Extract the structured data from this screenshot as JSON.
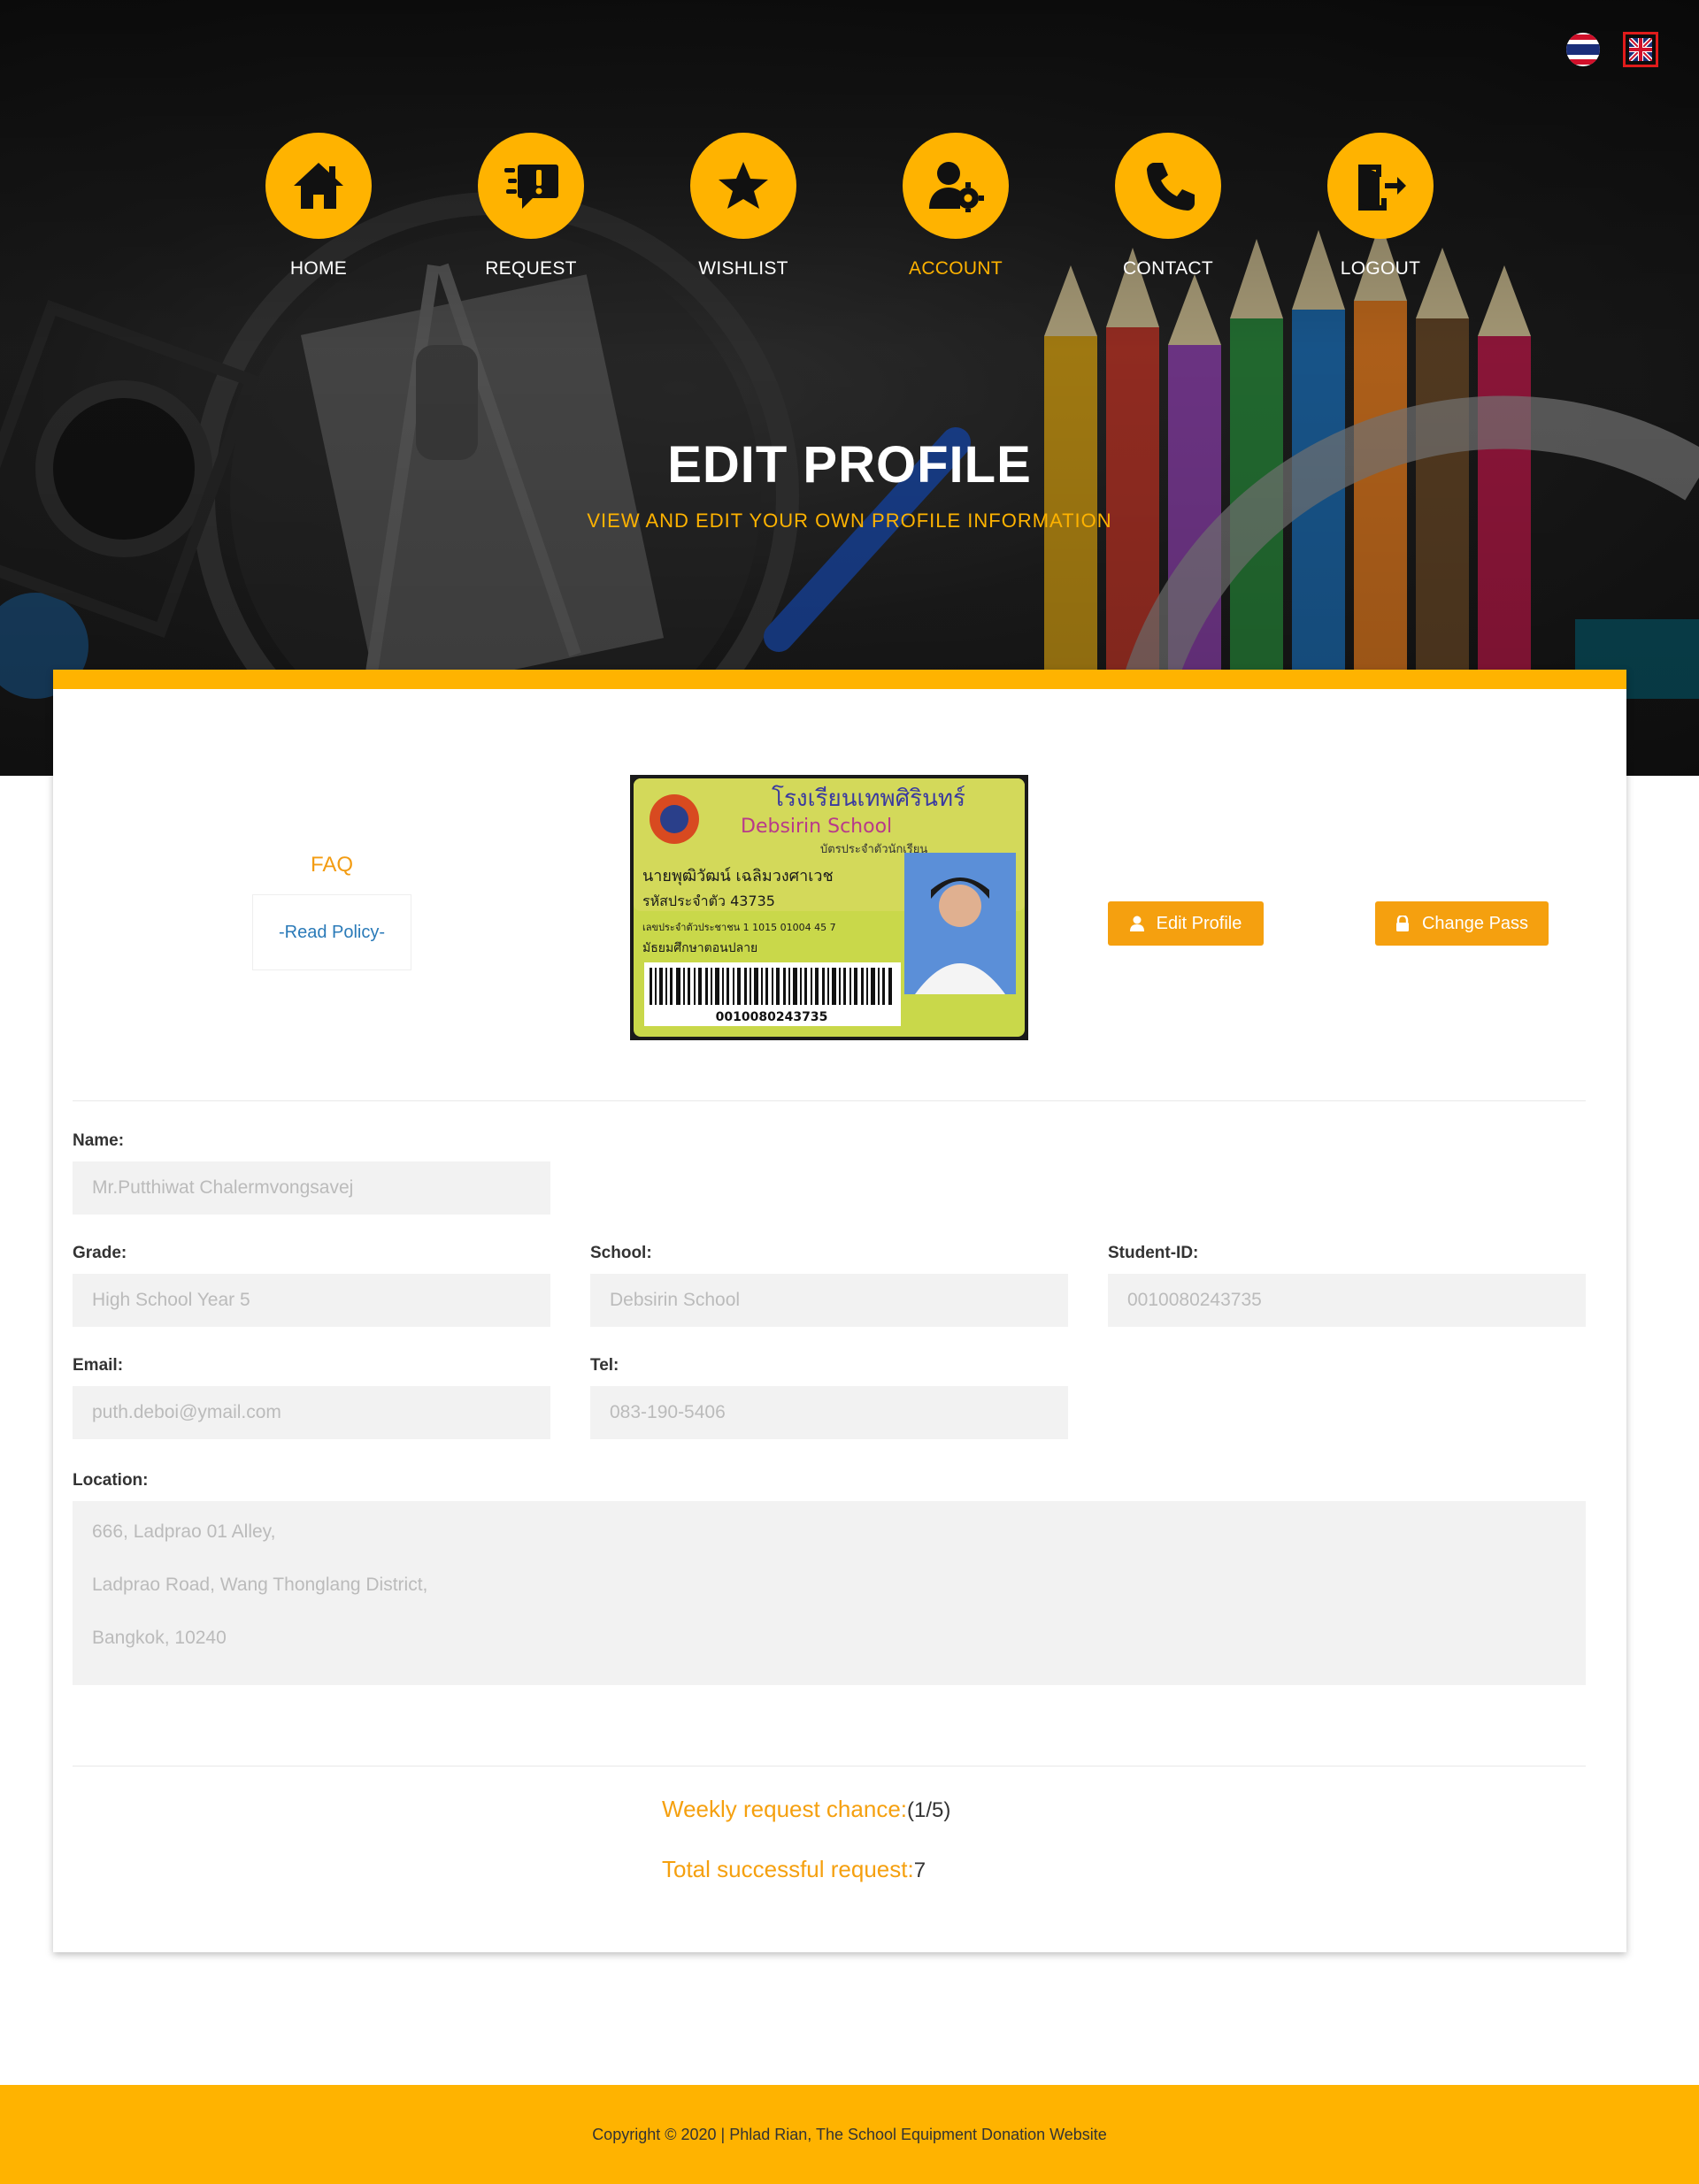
{
  "languages": [
    {
      "code": "th",
      "icon": "thai-flag-icon"
    },
    {
      "code": "en",
      "icon": "uk-flag-icon",
      "selected": true
    }
  ],
  "nav": {
    "items": [
      {
        "label": "HOME",
        "icon": "home-icon"
      },
      {
        "label": "REQUEST",
        "icon": "request-icon"
      },
      {
        "label": "WISHLIST",
        "icon": "star-icon"
      },
      {
        "label": "ACCOUNT",
        "icon": "user-gear-icon",
        "active": true
      },
      {
        "label": "CONTACT",
        "icon": "phone-icon"
      },
      {
        "label": "LOGOUT",
        "icon": "logout-door-icon"
      }
    ],
    "accent": "#ffb300"
  },
  "hero": {
    "title": "EDIT PROFILE",
    "subtitle": "VIEW AND EDIT YOUR OWN PROFILE INFORMATION"
  },
  "faq": {
    "title": "FAQ",
    "link": "-Read Policy-"
  },
  "id_card": {
    "school_thai": "โรงเรียนเทพศิรินทร์",
    "school_en": "Debsirin School",
    "card_title": "บัตรประจำตัวนักเรียน",
    "student_name": "นายพุฒิวัฒน์ เฉลิมวงศาเวช",
    "code_line": "รหัสประจำตัว 43735",
    "id_line": "เลขประจำตัวประชาชน 1 1015 01004 45 7",
    "level_line": "มัธยมศึกษาตอนปลาย",
    "barcode_number": "0010080243735"
  },
  "actions": {
    "edit_profile": "Edit Profile",
    "change_pass": "Change Pass"
  },
  "form": {
    "name_label": "Name:",
    "name_value": "Mr.Putthiwat Chalermvongsavej",
    "grade_label": "Grade:",
    "grade_value": "High School Year 5",
    "school_label": "School:",
    "school_value": "Debsirin School",
    "student_id_label": "Student-ID:",
    "student_id_value": "0010080243735",
    "email_label": "Email:",
    "email_value": "puth.deboi@ymail.com",
    "tel_label": "Tel:",
    "tel_value": "083-190-5406",
    "location_label": "Location:",
    "location_lines": [
      "666, Ladprao 01 Alley,",
      "Ladprao Road, Wang Thonglang District,",
      "Bangkok, 10240"
    ]
  },
  "stats": {
    "weekly_label": "Weekly request chance:",
    "weekly_value": "(1/5)",
    "total_label": "Total successful request:",
    "total_value": "7"
  },
  "footer": {
    "copyright": "Copyright © 2020 | Phlad Rian, The School Equipment Donation Website"
  }
}
